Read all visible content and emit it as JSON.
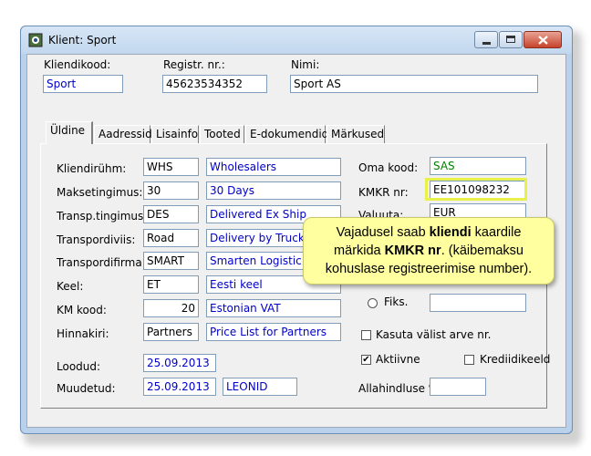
{
  "window": {
    "title": "Klient: Sport"
  },
  "header": {
    "kliendikood_label": "Kliendikood:",
    "kliendikood_value": "Sport",
    "registr_label": "Registr. nr.:",
    "registr_value": "45623534352",
    "nimi_label": "Nimi:",
    "nimi_value": "Sport AS"
  },
  "tabs": [
    "Üldine",
    "Aadressid",
    "Lisainfo",
    "Tooted",
    "E-dokumendid",
    "Märkused"
  ],
  "left_fields": [
    {
      "label": "Kliendirühm:",
      "code": "WHS",
      "desc": "Wholesalers"
    },
    {
      "label": "Maksetingimus:",
      "code": "30",
      "desc": "30 Days"
    },
    {
      "label": "Transp.tingimus:",
      "code": "DES",
      "desc": "Delivered Ex Ship"
    },
    {
      "label": "Transpordiviis:",
      "code": "Road",
      "desc": "Delivery by Truck"
    },
    {
      "label": "Transpordifirma:",
      "code": "SMART",
      "desc": "Smarten Logistic O"
    },
    {
      "label": "Keel:",
      "code": "ET",
      "desc": "Eesti keel"
    },
    {
      "label": "KM kood:",
      "code": "20",
      "desc": "Estonian VAT"
    },
    {
      "label": "Hinnakiri:",
      "code": "Partners",
      "desc": "Price List for Partners"
    }
  ],
  "loodud": {
    "label": "Loodud:",
    "value": "25.09.2013"
  },
  "muudetud": {
    "label": "Muudetud:",
    "value": "25.09.2013",
    "user": "LEONID"
  },
  "right": {
    "oma_kood_label": "Oma kood:",
    "oma_kood_value": "SAS",
    "kmkr_label": "KMKR nr:",
    "kmkr_value": "EE101098232",
    "valuuta_label": "Valuuta:",
    "valuuta_value": "EUR",
    "fiks_label": "Fiks.",
    "kasuta_label": "Kasuta välist arve nr.",
    "aktiivne_label": "Aktiivne",
    "krediidikeeld_label": "Krediidikeeld",
    "allahindluse_label": "Allahindluse %:"
  },
  "callout": {
    "part1": "Vajadusel saab ",
    "bold1": "kliendi",
    "part2": " kaardile",
    "part3": "märkida ",
    "bold2": "KMKR nr",
    "part4": ". (käibemaksu",
    "line3": "kohuslase registreerimise number)."
  }
}
